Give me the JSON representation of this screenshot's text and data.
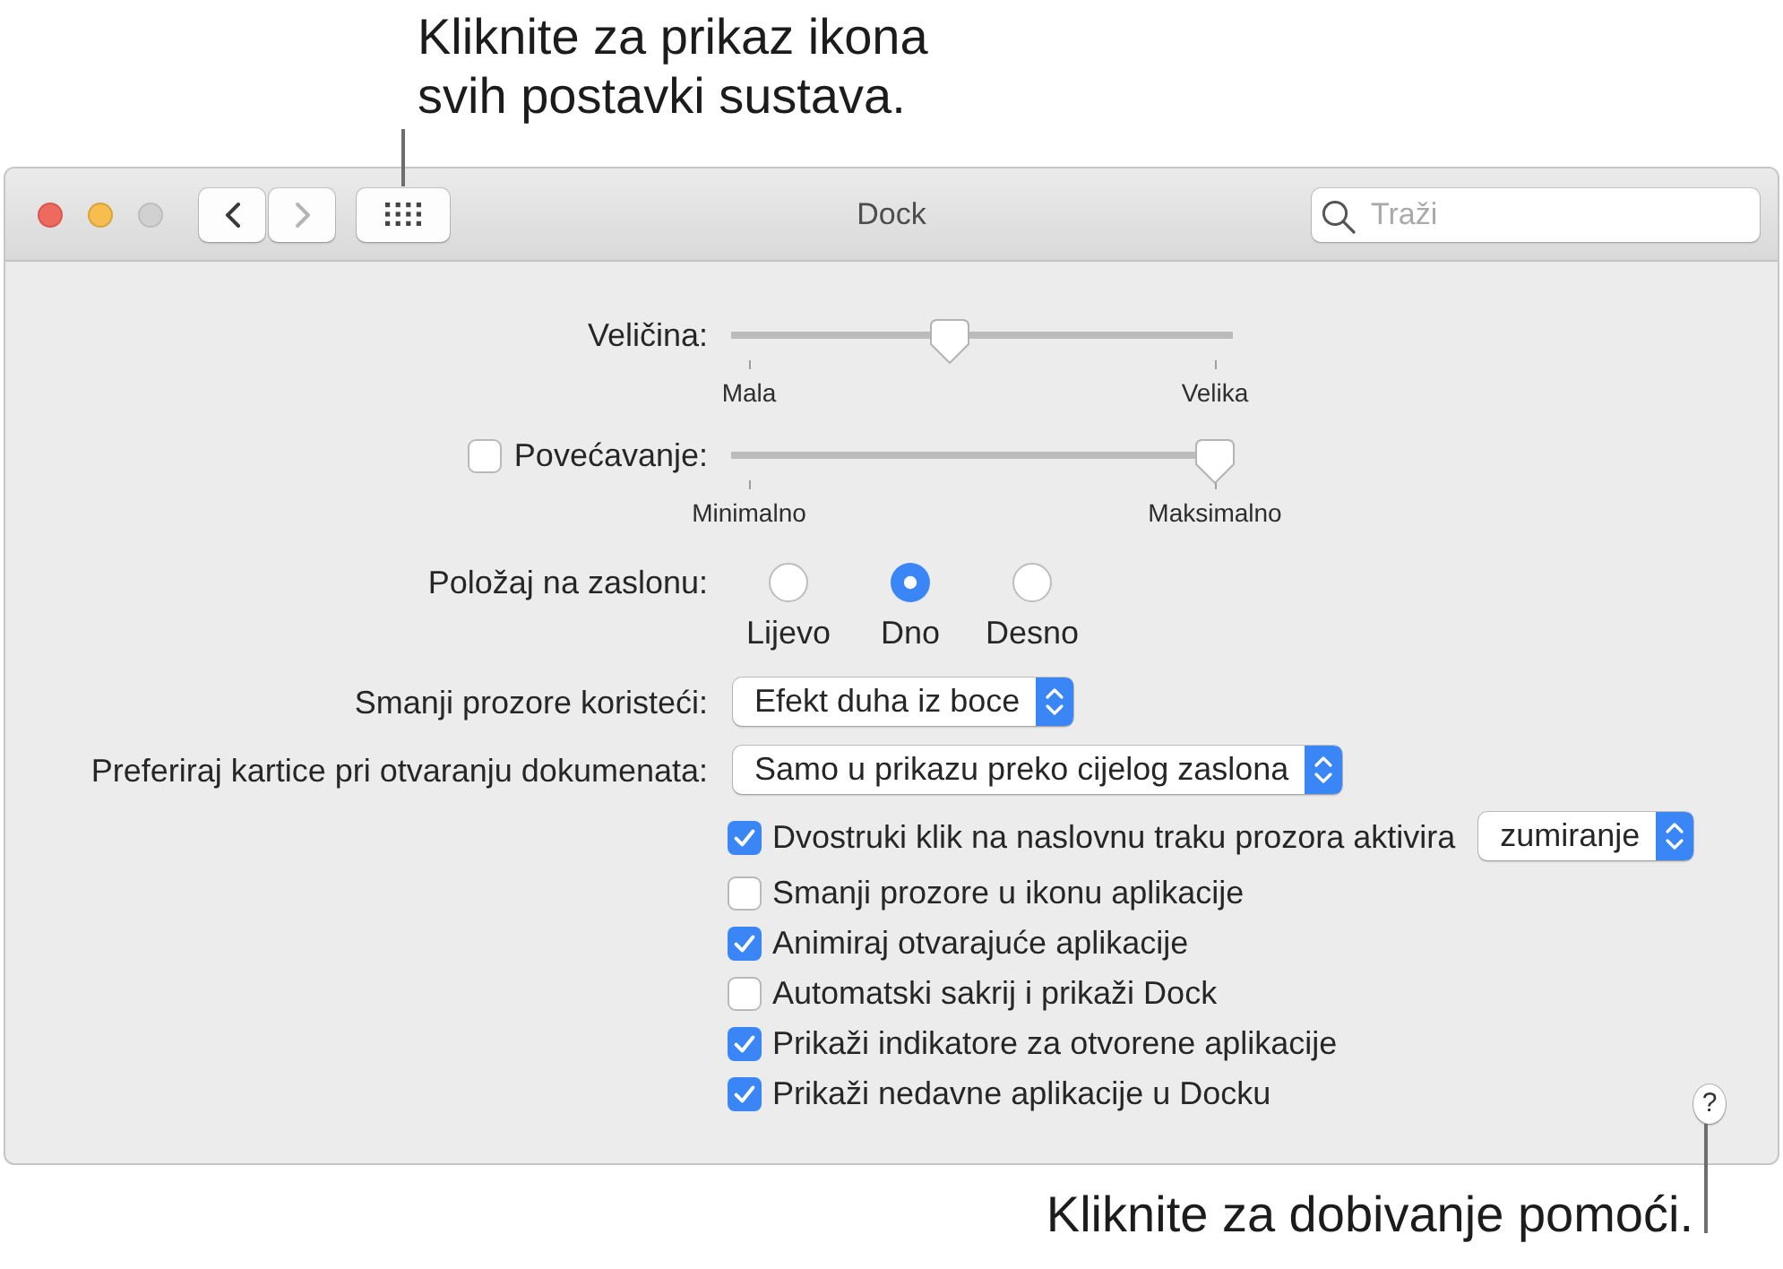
{
  "top_callout": {
    "text": "Kliknite za prikaz ikona svih postavki sustava."
  },
  "window": {
    "traffic_lights": [
      {
        "kind": "close",
        "disabled": false
      },
      {
        "kind": "minimize",
        "disabled": false
      },
      {
        "kind": "zoom",
        "disabled": true
      }
    ],
    "nav_buttons": [
      {
        "kind": "back",
        "disabled": false
      },
      {
        "kind": "forward",
        "disabled": true
      }
    ],
    "title": "Dock",
    "search": {
      "placeholder": "Traži"
    },
    "form": [
      {
        "kind": "slider",
        "label": "Veličina:",
        "level": 0.43,
        "min_label": "Mala",
        "max_label": "Velika"
      },
      {
        "kind": "slider",
        "label": "Povećavanje:",
        "checkbox": {
          "checked": false
        },
        "level": 1.0,
        "min_label": "Minimalno",
        "max_label": "Maksimalno"
      },
      {
        "kind": "radio_group",
        "label": "Položaj na zaslonu:",
        "options": [
          {
            "label": "Lijevo",
            "selected": false
          },
          {
            "label": "Dno",
            "selected": true
          },
          {
            "label": "Desno",
            "selected": false
          }
        ]
      },
      {
        "kind": "popup",
        "label": "Smanji prozore koristeći:",
        "value": "Efekt duha iz boce"
      },
      {
        "kind": "popup",
        "label": "Preferiraj kartice pri otvaranju dokumenata:",
        "value": "Samo u prikazu preko cijelog zaslona"
      }
    ],
    "checkboxes": [
      {
        "label": "Dvostruki klik na naslovnu traku prozora aktivira",
        "checked": true,
        "popup": {
          "value": "zumiranje"
        }
      },
      {
        "label": "Smanji prozore u ikonu aplikacije",
        "checked": false
      },
      {
        "label": "Animiraj otvarajuće aplikacije",
        "checked": true
      },
      {
        "label": "Automatski sakrij i prikaži Dock",
        "checked": false
      },
      {
        "label": "Prikaži indikatore za otvorene aplikacije",
        "checked": true
      },
      {
        "label": "Prikaži nedavne aplikacije u Docku",
        "checked": true
      }
    ],
    "help_button": {
      "label": "?"
    }
  },
  "bottom_callout": {
    "text": "Kliknite za dobivanje pomoći."
  }
}
